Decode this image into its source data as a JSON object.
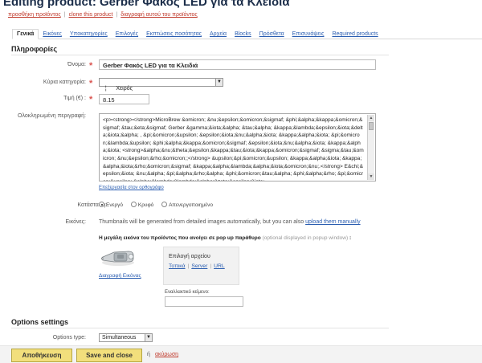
{
  "header": {
    "title": "Editing product: Gerber Φακός LED για τα Κλειδιά",
    "links": [
      "προσθήκη προϊόντος",
      "clone this product",
      "διαγραφή αυτού του προϊόντος"
    ]
  },
  "tabs": [
    "Γενικά",
    "Εικόνες",
    "Υποκατηγορίες",
    "Επιλογές",
    "Εκπτώσεις ποσότητας",
    "Αρχεία",
    "Blocks",
    "Πρόσθετα",
    "Επισυνάψεις",
    "Required products"
  ],
  "info_section": {
    "title": "Πληροφορίες",
    "name_label": "Όνομα:",
    "name_value": "Gerber Φακός LED για τα Κλειδιά",
    "category_label": "Κύρια κατηγορία:",
    "category_value": "¦      Χειρός",
    "price_label": "Τιμή (€) :",
    "price_value": "8.15",
    "description_label": "Ολοκληρωμένη περιγραφή:",
    "description_value": "<p><strong></strong>MicroBrew &omicron; &nu;&epsilon;&omicron;&sigmaf; &phi;&alpha;&kappa;&omicron;&sigmaf; &tau;&eta;&sigmaf; Gerber &gamma;&iota;&alpha; &tau;&alpha; &kappa;&lambda;&epsilon;&iota;&delta;&iota;&alpha; , &pi;&omicron;&upsilon; &epsilon;&iota;&nu;&alpha;&iota; &kappa;&alpha;&iota; &pi;&omicron;&lambda;&upsilon; &phi;&alpha;&kappa;&omicron;&sigmaf; &epsilon;&iota;&nu;&alpha;&iota; &kappa;&alpha;&iota; <strong>&alpha;&nu;&theta;&epsilon;&kappa;&tau;&iota;&kappa;&omicron;&sigmaf; &sigma;&tau;&omicron; &nu;&epsilon;&rho;&omicron;;</strong> &upsilon;&pi;&omicron;&upsilon; &kappa;&alpha;&iota; &kappa;&alpha;&iota;&rho;&omicron;&sigmaf; &kappa;&alpha;&lambda;&alpha;&iota;&omicron;&nu;.</strong> E&chi;&epsilon;&iota; &nu;&alpha; &pi;&alpha;&rho;&alpha; &phi;&omicron;&tau;&alpha; &phi;&alpha;&rho; &pi;&omicron;&upsilon; &alpha;&lambda;&lambda;&alpha;&zeta;&epsilon;&iota;",
    "editor_link": "Επεξεργασία στον ορθογράφο",
    "status_label": "Κατάσταση:",
    "status_options": [
      "Ενεργό",
      "Κρυφό",
      "Απενεργοποιημένο"
    ],
    "status_selected": "Ενεργό",
    "images_label": "Εικόνες:",
    "thumbnails_note": "Thumbnails will be generated from detailed images automatically, but you can also",
    "upload_link": "upload them manually",
    "popup_image_title": "Η μεγάλη εικόνα του προϊόντος που ανοίγει σε pop up παράθυρο",
    "popup_optional": "(optional displayed in popup window)",
    "delete_image_link": "Διαγραφή Εικόνας",
    "file_box_title": "Επιλογή αρχείου",
    "file_sources": [
      "Τοπικά",
      "Server",
      "URL"
    ],
    "alt_text_label": "Εναλλακτικό κείμενο:",
    "alt_text_value": ""
  },
  "options_section": {
    "title": "Options settings",
    "type_label": "Options type:",
    "type_value": "Simultaneous"
  },
  "footer": {
    "save_label": "Αποθήκευση",
    "save_close_label": "Save and close",
    "or_text": "ή",
    "cancel_label": "ακύρωση"
  },
  "colors": {
    "button_bg": "#f2df7c",
    "link": "#2a5db0",
    "danger_link": "#c0392b",
    "required_star": "#d9534f"
  }
}
